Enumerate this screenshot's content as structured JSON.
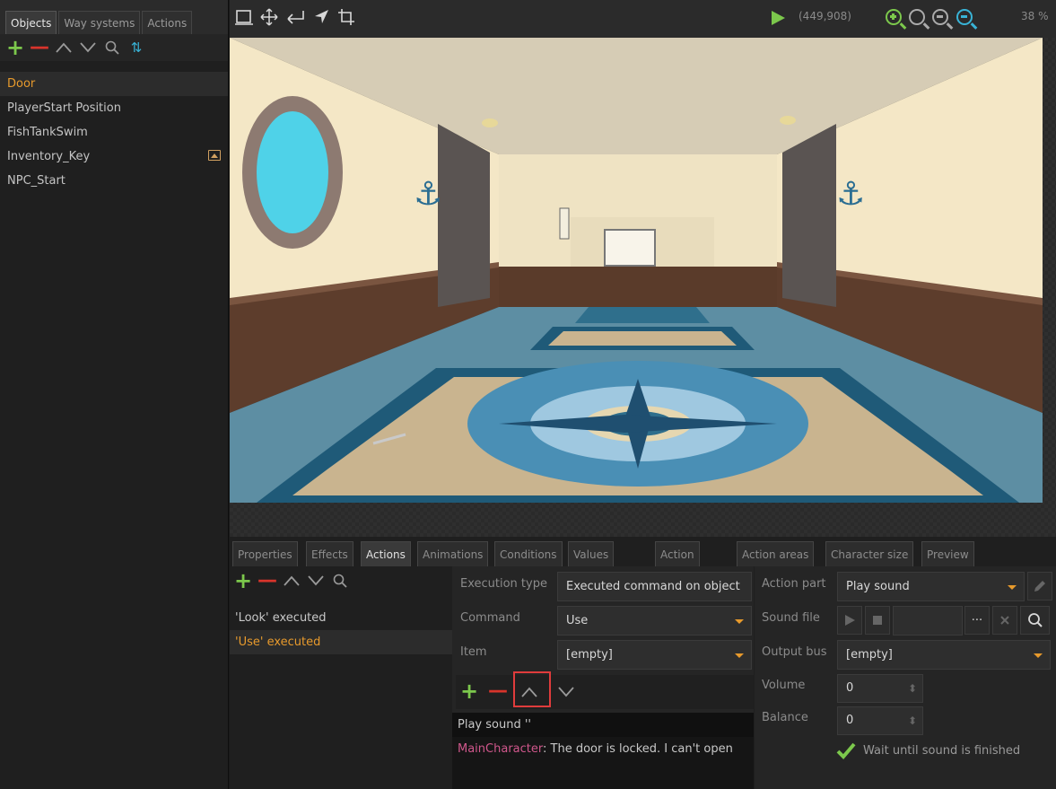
{
  "left_panel": {
    "tabs": [
      "Objects",
      "Way systems",
      "Actions"
    ],
    "objects": [
      {
        "label": "Door",
        "selected": true
      },
      {
        "label": "PlayerStart Position",
        "selected": false
      },
      {
        "label": "FishTankSwim",
        "selected": false
      },
      {
        "label": "Inventory_Key",
        "selected": false,
        "has_image": true
      },
      {
        "label": "NPC_Start",
        "selected": false
      }
    ]
  },
  "topbar": {
    "tools": [
      "select-rect-icon",
      "move-icon",
      "enter-icon",
      "pointer-icon",
      "crop-icon"
    ],
    "coords": "(449,908)",
    "zoom": "38 %"
  },
  "bottom": {
    "tabs": [
      {
        "label": "Properties",
        "active": false
      },
      {
        "label": "Effects",
        "active": false
      },
      {
        "label": "Actions",
        "active": true
      },
      {
        "label": "Animations",
        "active": false
      },
      {
        "label": "Conditions",
        "active": false
      },
      {
        "label": "Values",
        "active": false
      },
      {
        "label": "Action",
        "active": false
      },
      {
        "label": "Action areas",
        "active": false
      },
      {
        "label": "Character size",
        "active": false
      },
      {
        "label": "Preview",
        "active": false
      }
    ],
    "actions": [
      {
        "label": "'Look' executed",
        "selected": false
      },
      {
        "label": "'Use' executed",
        "selected": true
      }
    ],
    "execution_type": {
      "label": "Execution type",
      "value": "Executed command on object"
    },
    "command": {
      "label": "Command",
      "value": "Use"
    },
    "item": {
      "label": "Item",
      "value": "[empty]"
    },
    "action_parts": {
      "play_sound": "Play sound ''",
      "speaker": "MainCharacter",
      "speech": ": The door is locked. I can't open"
    },
    "action_part": {
      "label": "Action part",
      "value": "Play sound"
    },
    "sound_file": {
      "label": "Sound file",
      "more": "···"
    },
    "output_bus": {
      "label": "Output bus",
      "value": "[empty]"
    },
    "volume": {
      "label": "Volume",
      "value": "0"
    },
    "balance": {
      "label": "Balance",
      "value": "0"
    },
    "wait_checkbox": {
      "label": "Wait until sound is finished",
      "checked": true
    }
  },
  "colors": {
    "accent_orange": "#e79a2c",
    "add_green": "#7cc84c",
    "remove_red": "#d9342b",
    "highlight_red": "#e03c3c",
    "speaker_pink": "#d0578c"
  }
}
